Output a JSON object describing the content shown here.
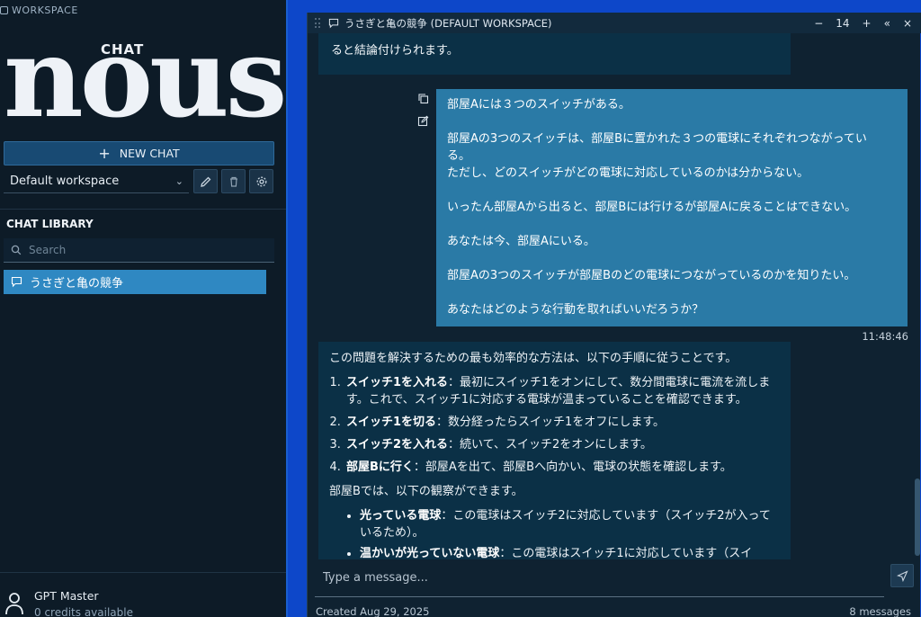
{
  "sidebar": {
    "workspace_label": "WORKSPACE",
    "logo_big": "nous",
    "logo_small": "CHAT",
    "new_chat_label": "NEW CHAT",
    "workspace_select": "Default workspace",
    "library_title": "CHAT LIBRARY",
    "search_placeholder": "Search",
    "chats": [
      {
        "title": "うさぎと亀の競争"
      }
    ],
    "user_name": "GPT Master",
    "credits": "0 credits available"
  },
  "chat": {
    "title": "うさぎと亀の競争 (DEFAULT WORKSPACE)",
    "page_count": "14",
    "controls": {
      "minus": "−",
      "plus": "+",
      "collapse": "«",
      "close": "×"
    },
    "prev_ai_tail": "ると結論付けられます。",
    "user_message": [
      "部屋Aには３つのスイッチがある。",
      "",
      "部屋Aの3つのスイッチは、部屋Bに置かれた３つの電球にそれぞれつながってい",
      "る。",
      "ただし、どのスイッチがどの電球に対応しているのかは分からない。",
      "",
      "いったん部屋Aから出ると、部屋Bには行けるが部屋Aに戻ることはできない。",
      "",
      "あなたは今、部屋Aにいる。",
      "",
      "部屋Aの3つのスイッチが部屋Bのどの電球につながっているのかを知りたい。",
      "",
      "あなたはどのような行動を取ればいいだろうか？"
    ],
    "user_time": "11:48:46",
    "ai_intro": "この問題を解決するための最も効率的な方法は、以下の手順に従うことです。",
    "steps": [
      {
        "bold": "スイッチ1を入れる",
        "text": "：最初にスイッチ1をオンにして、数分間電球に電流を流します。これで、スイッチ1に対応する電球が温まっていることを確認できます。"
      },
      {
        "bold": "スイッチ1を切る",
        "text": "：数分経ったらスイッチ1をオフにします。"
      },
      {
        "bold": "スイッチ2を入れる",
        "text": "：続いて、スイッチ2をオンにします。"
      },
      {
        "bold": "部屋Bに行く",
        "text": "：部屋Aを出て、部屋Bへ向かい、電球の状態を確認します。"
      }
    ],
    "observe_intro": "部屋Bでは、以下の観察ができます。",
    "observations": [
      {
        "bold": "光っている電球",
        "text": "：この電球はスイッチ2に対応しています（スイッチ2が入っているため）。"
      },
      {
        "bold": "温かいが光っていない電球",
        "text": "：この電球はスイッチ1に対応しています（スイ"
      }
    ],
    "input_placeholder": "Type a message...",
    "created": "Created Aug 29, 2025",
    "message_count": "8 messages"
  },
  "colors": {
    "desktop": "#0d47c9",
    "sidebar_bg": "#0d1b27",
    "chat_bg": "#0f2231",
    "user_bubble": "#2a7aa6",
    "ai_bubble": "#0b3046",
    "selected_chat": "#2f88c2"
  },
  "icons": [
    "workspace-icon",
    "plus-icon",
    "chevron-down-icon",
    "pencil-icon",
    "trash-icon",
    "gear-icon",
    "search-icon",
    "chat-bubble-icon",
    "user-icon",
    "copy-icon",
    "edit-icon",
    "send-icon"
  ]
}
